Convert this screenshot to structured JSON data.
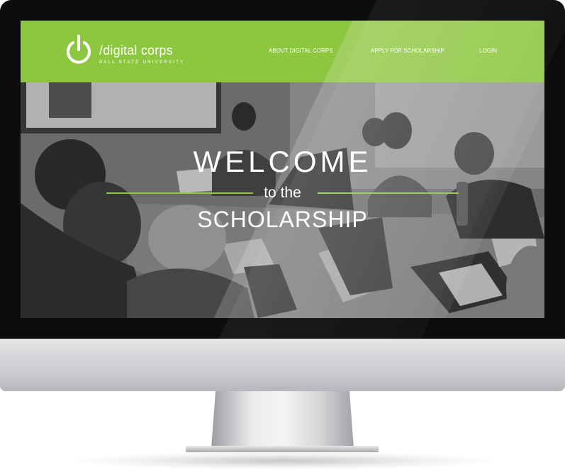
{
  "site": {
    "logo": {
      "name": "/digital corps",
      "subtitle": "BALL STATE UNIVERSITY",
      "icon": "power-icon"
    },
    "nav": {
      "about": "ABOUT DIGITAL CORPS",
      "apply": "APPLY FOR SCHOLARSHIP",
      "login": "LOGIN"
    },
    "hero": {
      "line1": "WELCOME",
      "line2": "to the",
      "line3": "SCHOLARSHIP"
    }
  },
  "colors": {
    "brand_green": "#8dc63f",
    "text": "#ffffff",
    "bezel": "#0c0c0d"
  }
}
